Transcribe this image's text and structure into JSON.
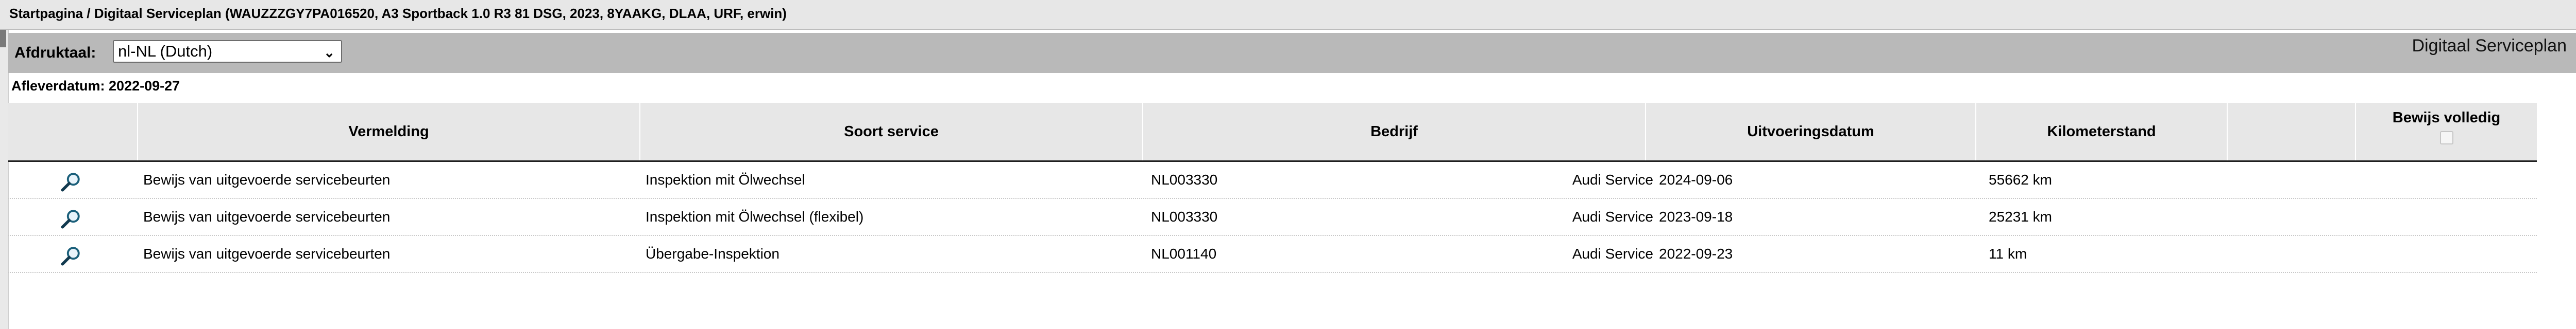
{
  "breadcrumb": "Startpagina / Digitaal Serviceplan (WAUZZZGY7PA016520, A3 Sportback 1.0 R3 81 DSG, 2023, 8YAAKG, DLAA, URF, erwin)",
  "language": {
    "label": "Afdruktaal:",
    "selected": "nl-NL (Dutch)"
  },
  "panel_title": "Digitaal Serviceplan",
  "delivery_date": "Afleverdatum: 2022-09-27",
  "table": {
    "headers": {
      "vermelding": "Vermelding",
      "soort_service": "Soort service",
      "bedrijf": "Bedrijf",
      "uitvoeringsdatum": "Uitvoeringsdatum",
      "kilometerstand": "Kilometerstand",
      "bewijs_volledig": "Bewijs volledig"
    },
    "rows": [
      {
        "icon": "magnifier-icon",
        "vermelding": "Bewijs van uitgevoerde servicebeurten",
        "soort_service": "Inspektion mit Ölwechsel",
        "bedrijf_code": "NL003330",
        "bedrijf_name": "Audi Service",
        "uitvoeringsdatum": "2024-09-06",
        "kilometerstand": "55662 km"
      },
      {
        "icon": "magnifier-icon",
        "vermelding": "Bewijs van uitgevoerde servicebeurten",
        "soort_service": "Inspektion mit Ölwechsel (flexibel)",
        "bedrijf_code": "NL003330",
        "bedrijf_name": "Audi Service",
        "uitvoeringsdatum": "2023-09-18",
        "kilometerstand": "25231 km"
      },
      {
        "icon": "magnifier-icon",
        "vermelding": "Bewijs van uitgevoerde servicebeurten",
        "soort_service": "Übergabe-Inspektion",
        "bedrijf_code": "NL001140",
        "bedrijf_name": "Audi Service",
        "uitvoeringsdatum": "2022-09-23",
        "kilometerstand": "11 km"
      }
    ]
  }
}
